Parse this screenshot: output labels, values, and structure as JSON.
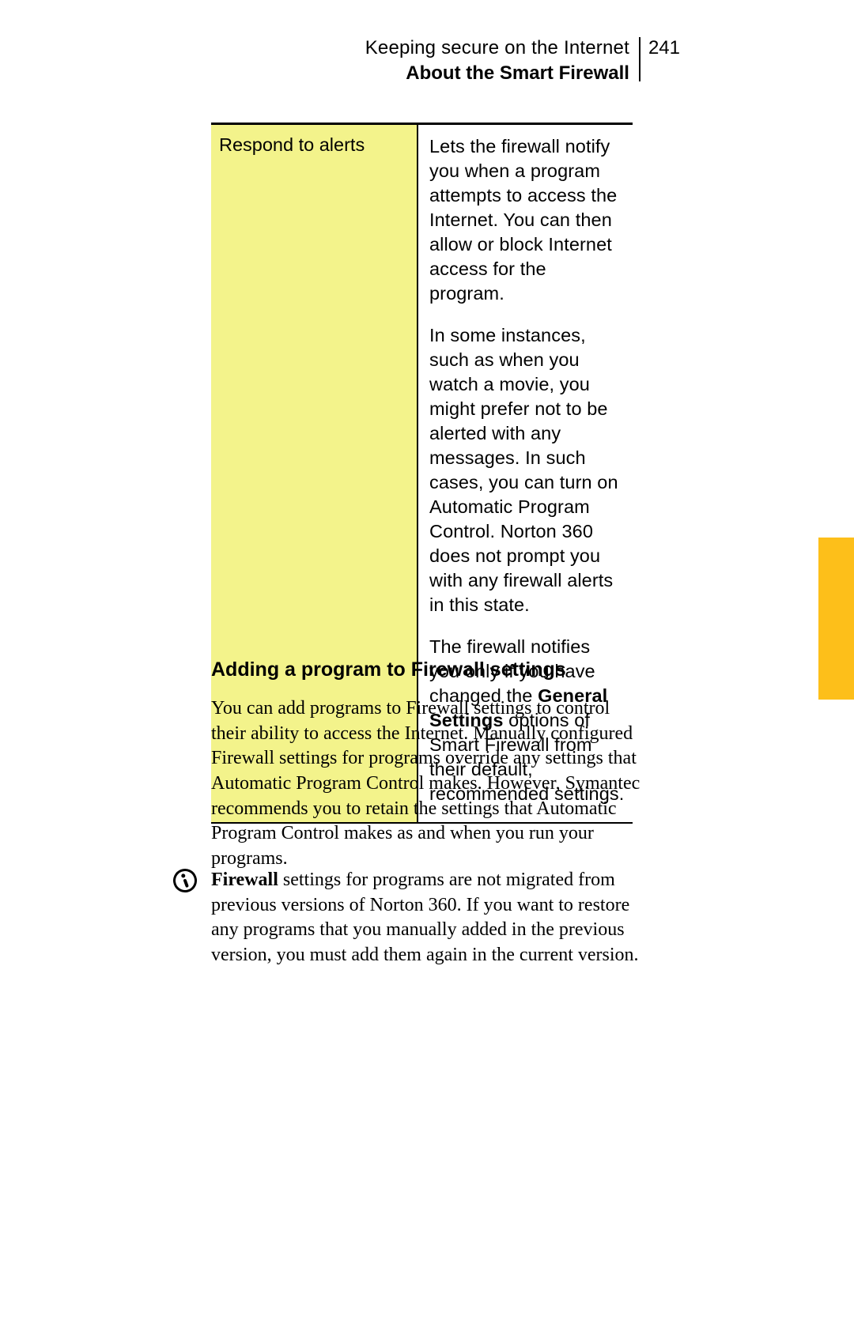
{
  "header": {
    "chapter": "Keeping secure on the Internet",
    "section": "About the Smart Firewall",
    "page_number": "241"
  },
  "table": {
    "left_label": "Respond to alerts",
    "right_p1": "Lets the firewall notify you when a program attempts to access the Internet. You can then allow or block Internet access for the program.",
    "right_p2": "In some instances, such as when you watch a movie, you might prefer not to be alerted with any messages. In such cases, you can turn on Automatic Program Control. Norton 360 does not prompt you with any firewall alerts in this state.",
    "right_p3_a": "The firewall notifies you only if you have changed the ",
    "right_p3_bold": "General Settings",
    "right_p3_b": " options of Smart Firewall from their default, recommended settings."
  },
  "subheading": "Adding a program to Firewall settings",
  "body1": "You can add programs to Firewall settings to control their ability to access the Internet. Manually configured Firewall settings for programs override any settings that Automatic Program Control makes. However, Symantec recommends you to retain the settings that Automatic Program Control makes as and when you run your programs.",
  "body2_bold": "Firewall",
  "body2_rest": " settings for programs are not migrated from previous versions of Norton 360. If you want to restore any programs that you manually added in the previous version, you must add them again in the current version."
}
